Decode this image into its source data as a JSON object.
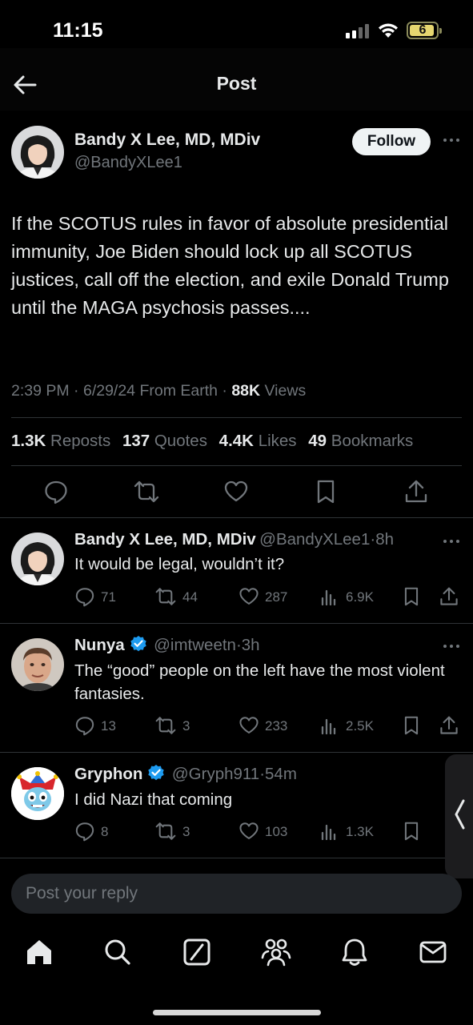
{
  "status_bar": {
    "time": "11:15",
    "battery": "6"
  },
  "header": {
    "title": "Post"
  },
  "post": {
    "author_name": "Bandy X Lee, MD, MDiv",
    "handle": "@BandyXLee1",
    "follow_label": "Follow",
    "text": "If the SCOTUS rules in favor of absolute presidential immunity, Joe Biden should lock up all SCOTUS justices, call off the election, and exile Donald Trump until the MAGA psychosis passes....",
    "time": "2:39 PM",
    "date": "6/29/24",
    "source": "From Earth",
    "views_count": "88K",
    "views_label": "Views",
    "reposts_count": "1.3K",
    "reposts_label": "Reposts",
    "quotes_count": "137",
    "quotes_label": "Quotes",
    "likes_count": "4.4K",
    "likes_label": "Likes",
    "bookmarks_count": "49",
    "bookmarks_label": "Bookmarks"
  },
  "replies": [
    {
      "name": "Bandy X Lee, MD, MDiv",
      "handle": "@BandyXLee1",
      "time": "8h",
      "verified": false,
      "text": "It would be legal, wouldn’t it?",
      "replies": "71",
      "reposts": "44",
      "likes": "287",
      "views": "6.9K"
    },
    {
      "name": "Nunya",
      "handle": "@imtweetn",
      "time": "3h",
      "verified": true,
      "text": "The “good” people on the left have the most violent fantasies.",
      "replies": "13",
      "reposts": "3",
      "likes": "233",
      "views": "2.5K"
    },
    {
      "name": "Gryphon",
      "handle": "@Gryph911",
      "time": "54m",
      "verified": true,
      "text": "I did Nazi that coming",
      "replies": "8",
      "reposts": "3",
      "likes": "103",
      "views": "1.3K"
    }
  ],
  "reply_bar": {
    "placeholder": "Post your reply"
  },
  "colors": {
    "background": "#000000",
    "text": "#e7e9ea",
    "muted": "#71767b",
    "verified": "#1d9bf0",
    "divider": "#2f3336"
  },
  "icons": [
    "back-arrow-icon",
    "more-icon",
    "reply-icon",
    "repost-icon",
    "like-icon",
    "views-icon",
    "bookmark-icon",
    "share-icon",
    "verified-icon",
    "home-icon",
    "search-icon",
    "grok-icon",
    "communities-icon",
    "notifications-icon",
    "messages-icon"
  ]
}
